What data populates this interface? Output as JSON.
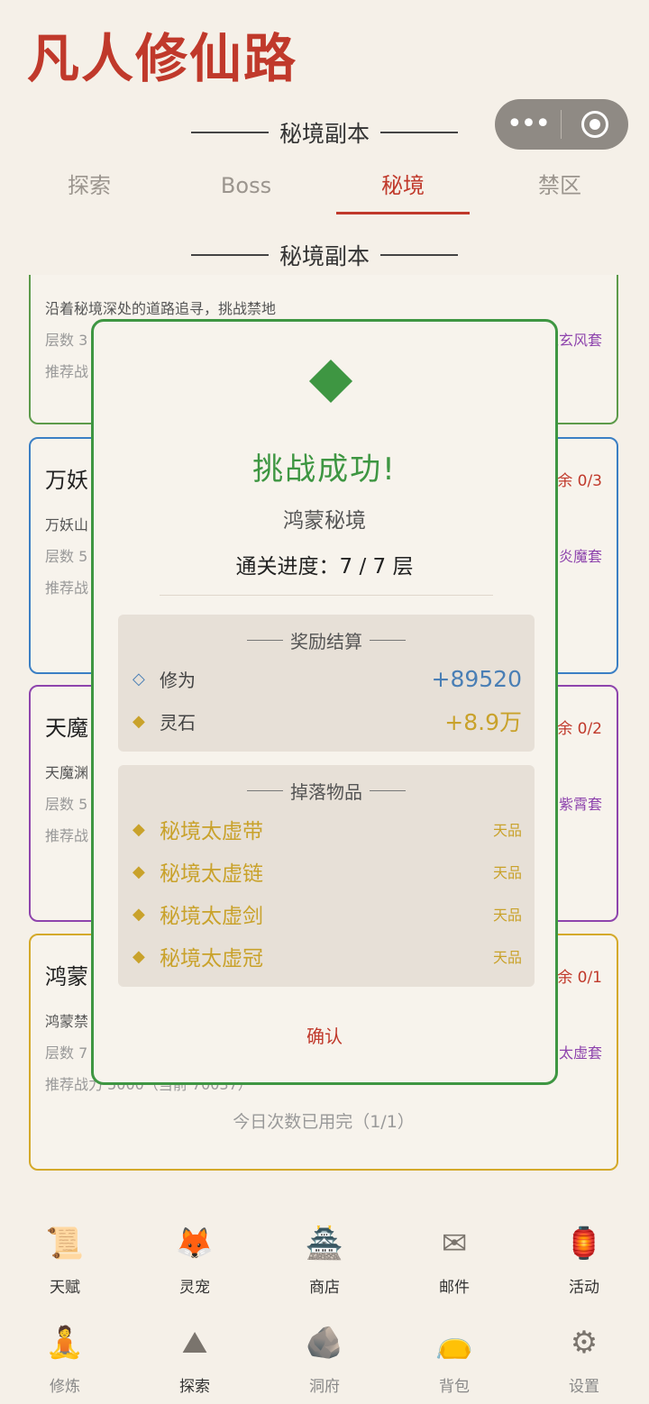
{
  "app": {
    "title": "凡人修仙路"
  },
  "header": {
    "section_title": "秘境副本"
  },
  "tabs": [
    {
      "label": "探索"
    },
    {
      "label": "Boss"
    },
    {
      "label": "秘境"
    },
    {
      "label": "禁区"
    }
  ],
  "list": {
    "section_title": "秘境副本",
    "cards": [
      {
        "name": "",
        "remain": "",
        "desc": "沿着秘境深处的道路追寻，挑战禁地",
        "floors": "层数 3 | 已通 3",
        "drop": "掉落：秘境玄风套",
        "power": "推荐战",
        "border_color": "#5c9a4a",
        "done": ""
      },
      {
        "name": "万妖",
        "remain": "余 0/3",
        "desc": "万妖山",
        "floors": "层数 5",
        "drop": "炎魔套",
        "power": "推荐战",
        "border_color": "#3b7fc4",
        "done": ""
      },
      {
        "name": "天魔",
        "remain": "余 0/2",
        "desc": "天魔渊",
        "floors": "层数 5",
        "drop": "紫霄套",
        "power": "推荐战",
        "border_color": "#8e44ad",
        "done": ""
      },
      {
        "name": "鸿蒙",
        "remain": "余 0/1",
        "desc": "鸿蒙禁",
        "floors": "层数 7",
        "drop": "太虚套",
        "power": "推荐战力 5000（当前 70037）",
        "border_color": "#d4a92a",
        "done": "今日次数已用完（1/1）"
      }
    ]
  },
  "nav_top": [
    {
      "label": "天赋",
      "icon": "scroll-icon",
      "glyph": "📜"
    },
    {
      "label": "灵宠",
      "icon": "fox-icon",
      "glyph": "🦊"
    },
    {
      "label": "商店",
      "icon": "shop-icon",
      "glyph": "🏯"
    },
    {
      "label": "邮件",
      "icon": "mail-icon",
      "glyph": "✉"
    },
    {
      "label": "活动",
      "icon": "lantern-icon",
      "glyph": "🏮"
    }
  ],
  "nav_bottom": [
    {
      "label": "修炼",
      "icon": "meditate-icon",
      "glyph": "🧘",
      "active": false
    },
    {
      "label": "探索",
      "icon": "mountain-icon",
      "glyph": "⛰",
      "active": true
    },
    {
      "label": "洞府",
      "icon": "cave-icon",
      "glyph": "🪨",
      "active": false
    },
    {
      "label": "背包",
      "icon": "bag-icon",
      "glyph": "👝",
      "active": false
    },
    {
      "label": "设置",
      "icon": "gear-icon",
      "glyph": "⚙",
      "active": false
    }
  ],
  "modal": {
    "title": "挑战成功!",
    "realm": "鸿蒙秘境",
    "progress": "通关进度：7 / 7 层",
    "rewards_title": "奖励结算",
    "rewards": [
      {
        "label": "修为",
        "value": "+89520",
        "marker": "◇",
        "color": "#4a7fb5"
      },
      {
        "label": "灵石",
        "value": "+8.9万",
        "marker": "◆",
        "color": "#c9a22b"
      }
    ],
    "drops_title": "掉落物品",
    "drops": [
      {
        "name": "秘境太虚带",
        "grade": "天品"
      },
      {
        "name": "秘境太虚链",
        "grade": "天品"
      },
      {
        "name": "秘境太虚剑",
        "grade": "天品"
      },
      {
        "name": "秘境太虚冠",
        "grade": "天品"
      }
    ],
    "confirm_label": "确认",
    "accent_color": "#3e9642"
  }
}
